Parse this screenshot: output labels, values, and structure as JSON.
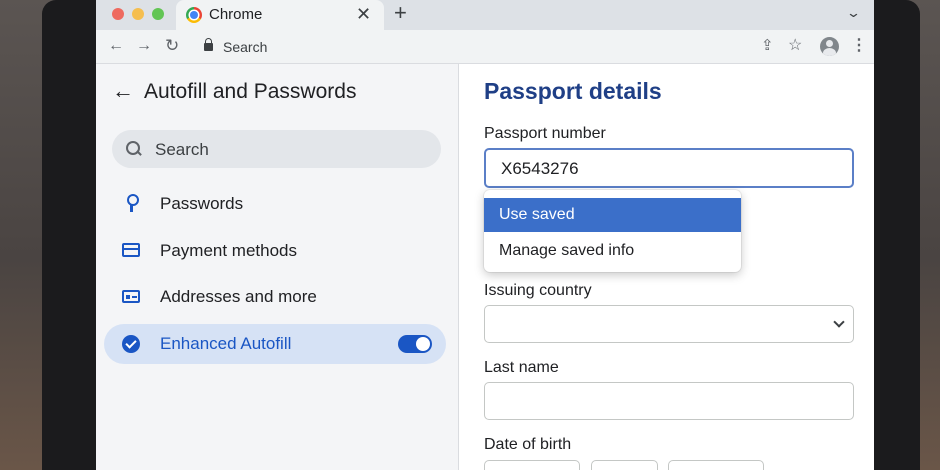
{
  "browser": {
    "tab_title": "Chrome",
    "tab_close_glyph": "✕",
    "new_tab_glyph": "+",
    "tab_menu_glyph": "⌄",
    "omnibox_text": "Search",
    "icons": {
      "back": "←",
      "forward": "→",
      "reload": "↻",
      "share": "⇪",
      "bookmark": "☆",
      "menu": "⋮"
    }
  },
  "sidebar": {
    "back_glyph": "←",
    "title": "Autofill and Passwords",
    "search_placeholder": "Search",
    "items": [
      {
        "label": "Passwords",
        "icon": "key-icon"
      },
      {
        "label": "Payment methods",
        "icon": "credit-card-icon"
      },
      {
        "label": "Addresses and more",
        "icon": "id-card-icon"
      },
      {
        "label": "Enhanced Autofill",
        "icon": "check-circle-icon",
        "active": true,
        "toggle_on": true
      }
    ]
  },
  "main": {
    "title": "Passport details",
    "passport_label": "Passport number",
    "passport_value": "X6543276",
    "dropdown": {
      "items": [
        {
          "label": "Use saved",
          "selected": true
        },
        {
          "label": "Manage saved info",
          "selected": false
        }
      ]
    },
    "issuing_country_label": "Issuing country",
    "issuing_country_value": "",
    "last_name_label": "Last name",
    "last_name_value": "",
    "dob_label": "Date of birth"
  },
  "colors": {
    "accent": "#1a56c4",
    "title_blue": "#1f3f86",
    "dropdown_selected": "#3b6fc9",
    "sidebar_bg": "#f4f5f7",
    "active_item_bg": "#d6e2f5"
  }
}
